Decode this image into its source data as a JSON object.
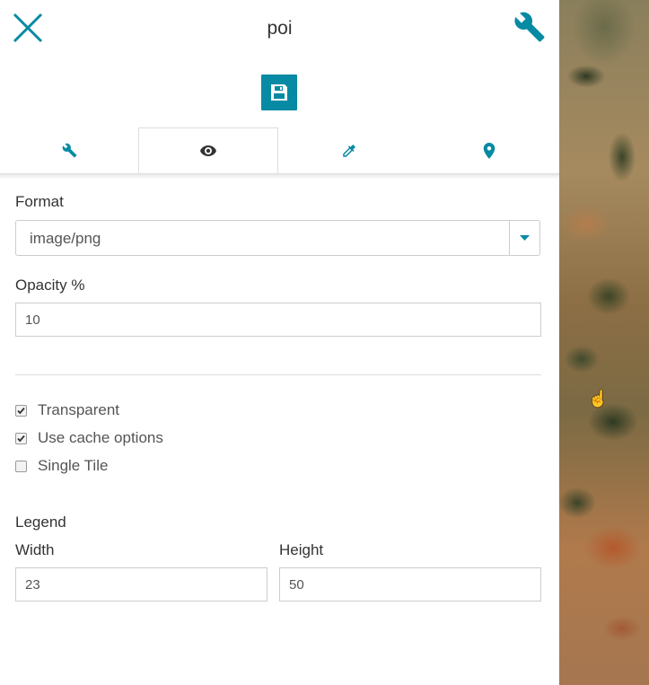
{
  "header": {
    "title": "poi"
  },
  "icons": {
    "close": "close-icon",
    "settings": "wrench-icon",
    "save": "floppy-disk-icon",
    "tabs": [
      "wrench-icon",
      "eye-icon",
      "eyedropper-icon",
      "map-marker-icon"
    ]
  },
  "colors": {
    "accent": "#078aa3",
    "text": "#333333"
  },
  "tabs": {
    "active_index": 1
  },
  "form": {
    "format_label": "Format",
    "format_value": "image/png",
    "opacity_label": "Opacity %",
    "opacity_value": "10",
    "checkboxes": [
      {
        "label": "Transparent",
        "checked": true
      },
      {
        "label": "Use cache options",
        "checked": true
      },
      {
        "label": "Single Tile",
        "checked": false
      }
    ],
    "legend_label": "Legend",
    "width_label": "Width",
    "width_value": "23",
    "height_label": "Height",
    "height_value": "50"
  }
}
